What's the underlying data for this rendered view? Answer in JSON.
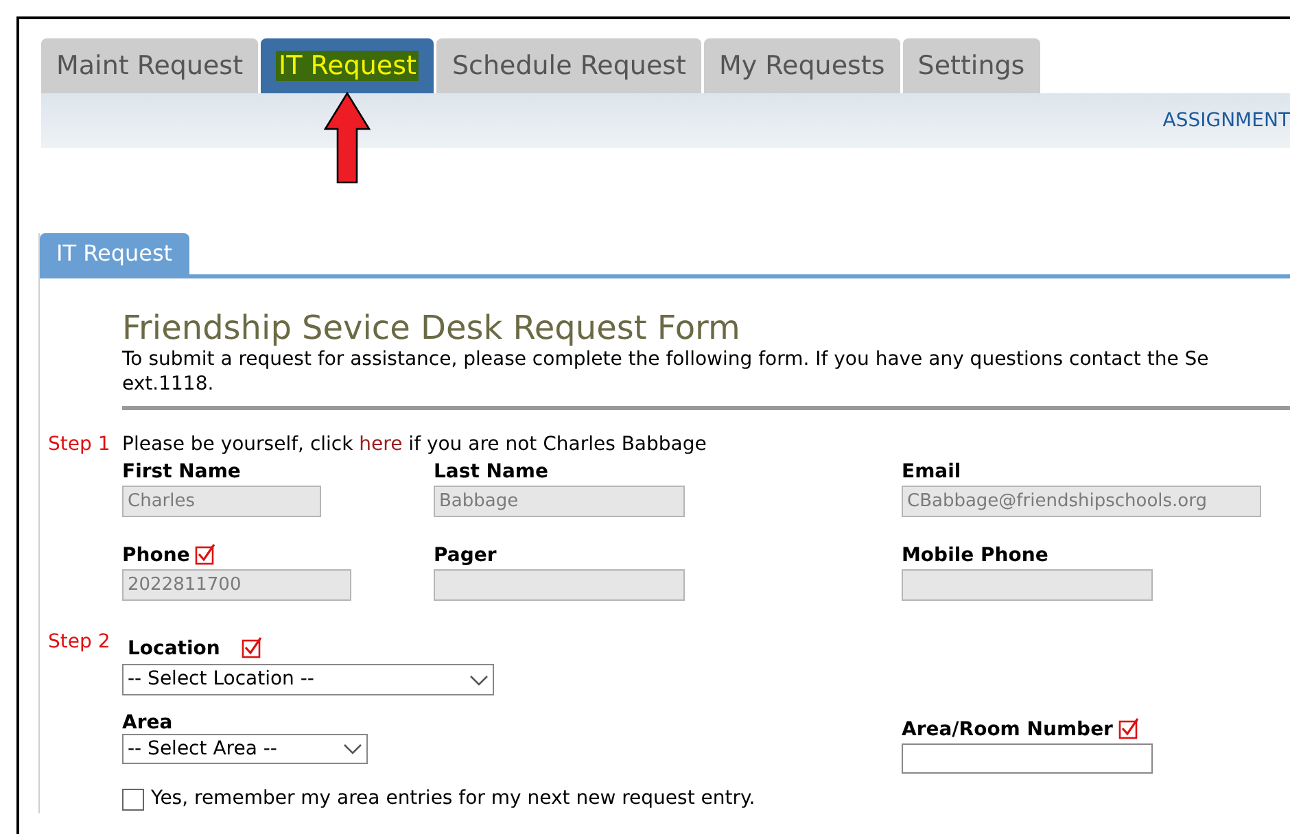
{
  "tabs": [
    {
      "label": "Maint Request",
      "selected": false,
      "highlighted": false
    },
    {
      "label": "IT Request",
      "selected": true,
      "highlighted": true
    },
    {
      "label": "Schedule Request",
      "selected": false,
      "highlighted": false
    },
    {
      "label": "My Requests",
      "selected": false,
      "highlighted": false
    },
    {
      "label": "Settings",
      "selected": false,
      "highlighted": false
    }
  ],
  "toolbar_link": "ASSIGNMENT",
  "panel_tab": "IT Request",
  "form": {
    "title": "Friendship Sevice Desk Request Form",
    "intro": "To submit a request for assistance, please complete the following form. If you have any questions contact the Se",
    "intro_line_2": "ext.1118.",
    "step_1": {
      "label": "Step 1",
      "sentence_before": "Please be yourself, click ",
      "link": "here",
      "sentence_after": " if you are not Charles Babbage"
    },
    "fields_row_1": [
      {
        "label": "First Name",
        "value": "Charles",
        "required": false
      },
      {
        "label": "Last Name",
        "value": "Babbage",
        "required": false
      },
      {
        "label": "Email",
        "value": "CBabbage@friendshipschools.org",
        "required": false
      }
    ],
    "fields_row_2": [
      {
        "label": "Phone",
        "value": "2022811700",
        "required": true
      },
      {
        "label": "Pager",
        "required": false
      },
      {
        "label": "Mobile Phone",
        "required": false
      }
    ],
    "step_2": {
      "label": "Step 2"
    },
    "location": {
      "label": "Location",
      "value": "-- Select Location --",
      "required": true
    },
    "area": {
      "label": "Area",
      "value": "-- Select Area --"
    },
    "room": {
      "label": "Area/Room Number",
      "required": true
    },
    "remember": {
      "label": "Yes, remember my area entries for my next new request entry.",
      "checked": false
    }
  }
}
